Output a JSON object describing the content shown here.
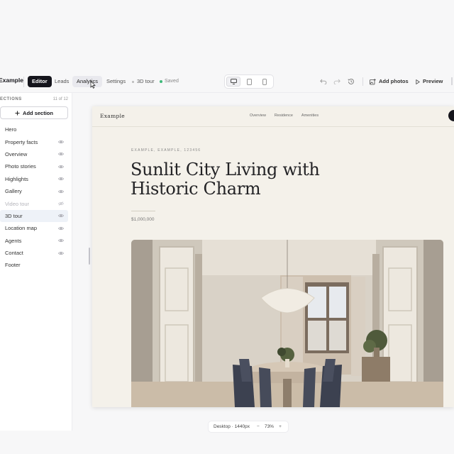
{
  "app": {
    "brand": "Example"
  },
  "nav": {
    "tabs": [
      {
        "label": "Editor"
      },
      {
        "label": "Leads"
      },
      {
        "label": "Analytics"
      },
      {
        "label": "Settings"
      }
    ],
    "breadcrumb": "3D tour",
    "status": "Saved",
    "active_tab": "Editor",
    "hover_tab": "Analytics"
  },
  "device_toggle": {
    "options": [
      "desktop",
      "tablet",
      "mobile"
    ],
    "selected": "desktop"
  },
  "toolbar": {
    "add_photos": "Add photos",
    "preview": "Preview"
  },
  "sidebar": {
    "heading": "ECTIONS",
    "count": "11 of 12",
    "add_section": "Add section",
    "items": [
      {
        "label": "Hero",
        "visible": null
      },
      {
        "label": "Property facts",
        "visible": true
      },
      {
        "label": "Overview",
        "visible": true
      },
      {
        "label": "Photo stories",
        "visible": true
      },
      {
        "label": "Highlights",
        "visible": true
      },
      {
        "label": "Gallery",
        "visible": true
      },
      {
        "label": "Video tour",
        "visible": false
      },
      {
        "label": "3D tour",
        "visible": true,
        "selected": true
      },
      {
        "label": "Location map",
        "visible": true
      },
      {
        "label": "Agents",
        "visible": true
      },
      {
        "label": "Contact",
        "visible": true
      },
      {
        "label": "Footer",
        "visible": null
      }
    ]
  },
  "site": {
    "logo": "Example",
    "links": [
      "Overview",
      "Residence",
      "Amenities"
    ],
    "address": "EXAMPLE, EXAMPLE, 123456",
    "title": "Sunlit City Living with Historic Charm",
    "price": "$1,000,000"
  },
  "zoom": {
    "viewport": "Desktop · 1440px",
    "minus": "−",
    "percent": "73%",
    "plus": "+"
  },
  "colors": {
    "accent": "#15151c",
    "saved": "#3fb97a",
    "selected_row": "#eef2f8",
    "site_bg": "#f4f1ea"
  }
}
